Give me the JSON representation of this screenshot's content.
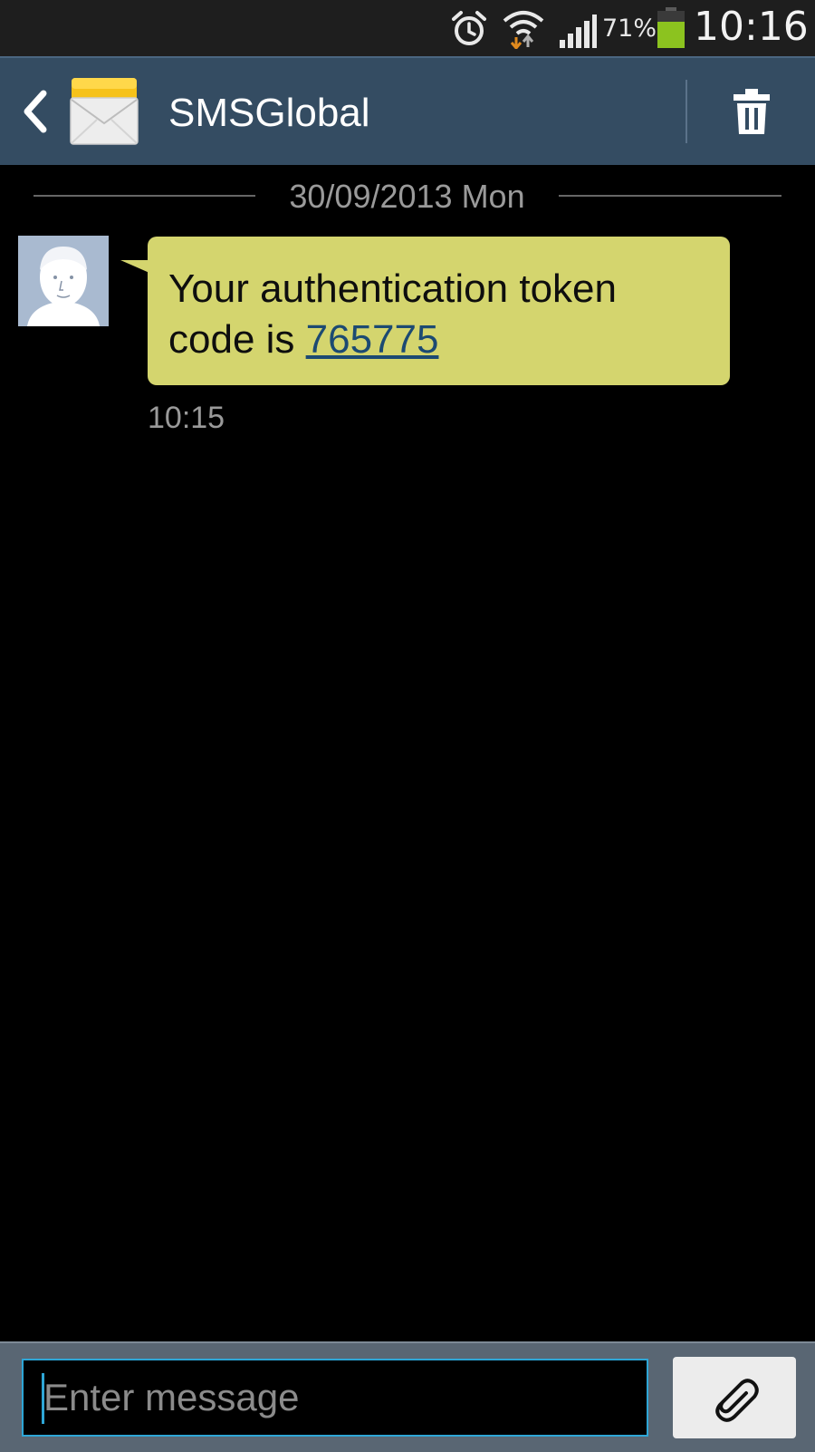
{
  "status_bar": {
    "battery_percent": "71%",
    "battery_level": 0.71,
    "battery_color": "#8cc31f",
    "time": "10:16",
    "icons": [
      "alarm-icon",
      "wifi-icon",
      "signal-icon",
      "battery-icon"
    ]
  },
  "header": {
    "title": "SMSGlobal",
    "back_icon": "chevron-left-icon",
    "contact_icon": "envelope-icon",
    "delete_icon": "trash-icon",
    "background_color": "#344c62"
  },
  "conversation": {
    "date_separator": "30/09/2013 Mon",
    "messages": [
      {
        "text_prefix": "Your authentication token code is ",
        "link_text": "765775",
        "time": "10:15",
        "bubble_color": "#d4d56e",
        "avatar_icon": "person-avatar-icon"
      }
    ]
  },
  "composer": {
    "placeholder": "Enter message",
    "value": "",
    "attach_icon": "paperclip-icon",
    "accent_color": "#2ea6d6"
  }
}
